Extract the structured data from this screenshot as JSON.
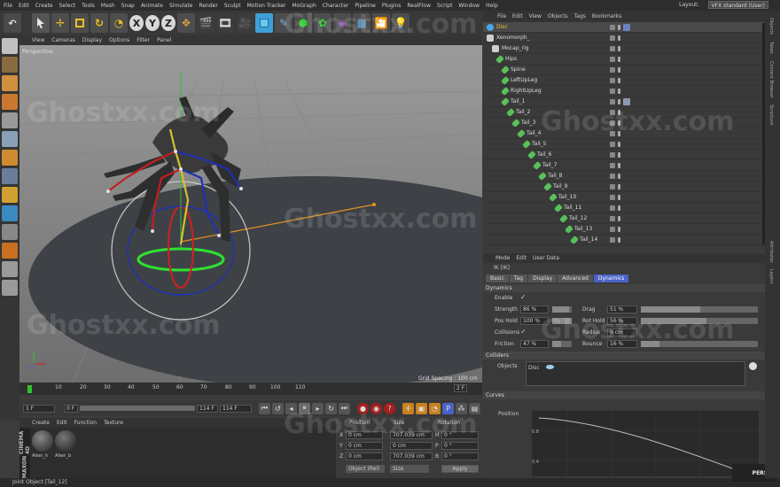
{
  "menubar": {
    "items": [
      "File",
      "Edit",
      "Create",
      "Select",
      "Tools",
      "Mesh",
      "Snap",
      "Animate",
      "Simulate",
      "Render",
      "Sculpt",
      "Motion Tracker",
      "MoGraph",
      "Character",
      "Pipeline",
      "Plugins",
      "RealFlow",
      "Script",
      "Window",
      "Help"
    ],
    "layout_label": "Layout:",
    "layout_value": "VFX standard (User)"
  },
  "toolbar": {
    "x": "X",
    "y": "Y",
    "z": "Z"
  },
  "viewport": {
    "menu": [
      "View",
      "Cameras",
      "Display",
      "Options",
      "Filter",
      "Panel"
    ],
    "camera": "Perspective",
    "grid_spacing": "Grid Spacing : 100 cm"
  },
  "timeline": {
    "ticks": [
      "0",
      "10",
      "20",
      "30",
      "40",
      "50",
      "60",
      "70",
      "80",
      "90",
      "100",
      "110"
    ],
    "end_frame": "2 F",
    "current_frame": "1 F",
    "start_field": "0 F",
    "range_end": "114 F",
    "max_field": "114 F"
  },
  "materials": {
    "menu": [
      "Create",
      "Edit",
      "Function",
      "Texture"
    ],
    "items": [
      "Alien_h",
      "Alien_b"
    ],
    "brand_top": "MAXON",
    "brand_bottom": "CINEMA 4D"
  },
  "coords": {
    "headers": [
      "Position",
      "Size",
      "Rotation"
    ],
    "rows": [
      {
        "axis": "X",
        "pos": "0 cm",
        "size": "707.039 cm",
        "rot_axis": "H",
        "rot": "0 °"
      },
      {
        "axis": "Y",
        "pos": "0 cm",
        "size": "0 cm",
        "rot_axis": "P",
        "rot": "0 °"
      },
      {
        "axis": "Z",
        "pos": "0 cm",
        "size": "707.039 cm",
        "rot_axis": "B",
        "rot": "0 °"
      }
    ],
    "mode": "Object (Rel)",
    "size_mode": "Size",
    "apply": "Apply"
  },
  "object_manager": {
    "menu": [
      "File",
      "Edit",
      "View",
      "Objects",
      "Tags",
      "Bookmarks"
    ],
    "objects": [
      {
        "name": "Disc",
        "depth": 0
      },
      {
        "name": "Xenomorph_",
        "depth": 0
      },
      {
        "name": "Mocap_rig",
        "depth": 1
      },
      {
        "name": "Hips",
        "depth": 2
      },
      {
        "name": "Spine",
        "depth": 3
      },
      {
        "name": "LeftUpLeg",
        "depth": 3
      },
      {
        "name": "RightUpLeg",
        "depth": 3
      },
      {
        "name": "Tail_1",
        "depth": 3
      },
      {
        "name": "Tail_2",
        "depth": 4
      },
      {
        "name": "Tail_3",
        "depth": 5
      },
      {
        "name": "Tail_4",
        "depth": 6
      },
      {
        "name": "Tail_5",
        "depth": 7
      },
      {
        "name": "Tail_6",
        "depth": 8
      },
      {
        "name": "Tail_7",
        "depth": 9
      },
      {
        "name": "Tail_8",
        "depth": 10
      },
      {
        "name": "Tail_9",
        "depth": 11
      },
      {
        "name": "Tail_10",
        "depth": 12
      },
      {
        "name": "Tail_11",
        "depth": 13
      },
      {
        "name": "Tail_12",
        "depth": 14
      },
      {
        "name": "Tail_13",
        "depth": 15
      },
      {
        "name": "Tail_14",
        "depth": 16
      }
    ]
  },
  "attributes": {
    "menu": [
      "Mode",
      "Edit",
      "User Data"
    ],
    "title": "IK [IK]",
    "tabs": [
      "Basic",
      "Tag",
      "Display",
      "Advanced",
      "Dynamics"
    ],
    "active_tab": "Dynamics",
    "section": "Dynamics",
    "enable_label": "Enable",
    "strength_label": "Strength",
    "strength": "86 %",
    "strength_fraction": 0.86,
    "drag_label": "Drag",
    "drag": "51 %",
    "drag_fraction": 0.51,
    "pos_hold_label": "Pos Hold",
    "pos_hold": "100 %",
    "pos_hold_fraction": 1.0,
    "rot_hold_label": "Rot Hold",
    "rot_hold": "56 %",
    "rot_hold_fraction": 0.56,
    "collisions_label": "Collisions",
    "radius_label": "Radius",
    "radius": "9 cm",
    "friction_label": "Friction",
    "friction": "47 %",
    "friction_fraction": 0.47,
    "bounce_label": "Bounce",
    "bounce": "16 %",
    "bounce_fraction": 0.16,
    "colliders_section": "Colliders",
    "objects_label": "Objects",
    "collider_item": "Disc",
    "curves_section": "Curves",
    "position_label": "Position",
    "curve_ticks": [
      "0.8",
      "0.4"
    ]
  },
  "right_strip": [
    "Objects",
    "Takes",
    "Content Browser",
    "Structure",
    "Attributes",
    "Layers"
  ],
  "status": "Joint Object [Tail_12]",
  "watermark": "Ghostxx.com",
  "logo_text": "PERSIA",
  "colors": {
    "accent_tab": "#4a63c8",
    "ground": "#3d4146",
    "sky": "#8e8e8e",
    "skeleton_red": "#c02020",
    "skeleton_blue": "#2030b0",
    "gizmo_green": "#30e030",
    "guide_orange": "#e89020"
  }
}
